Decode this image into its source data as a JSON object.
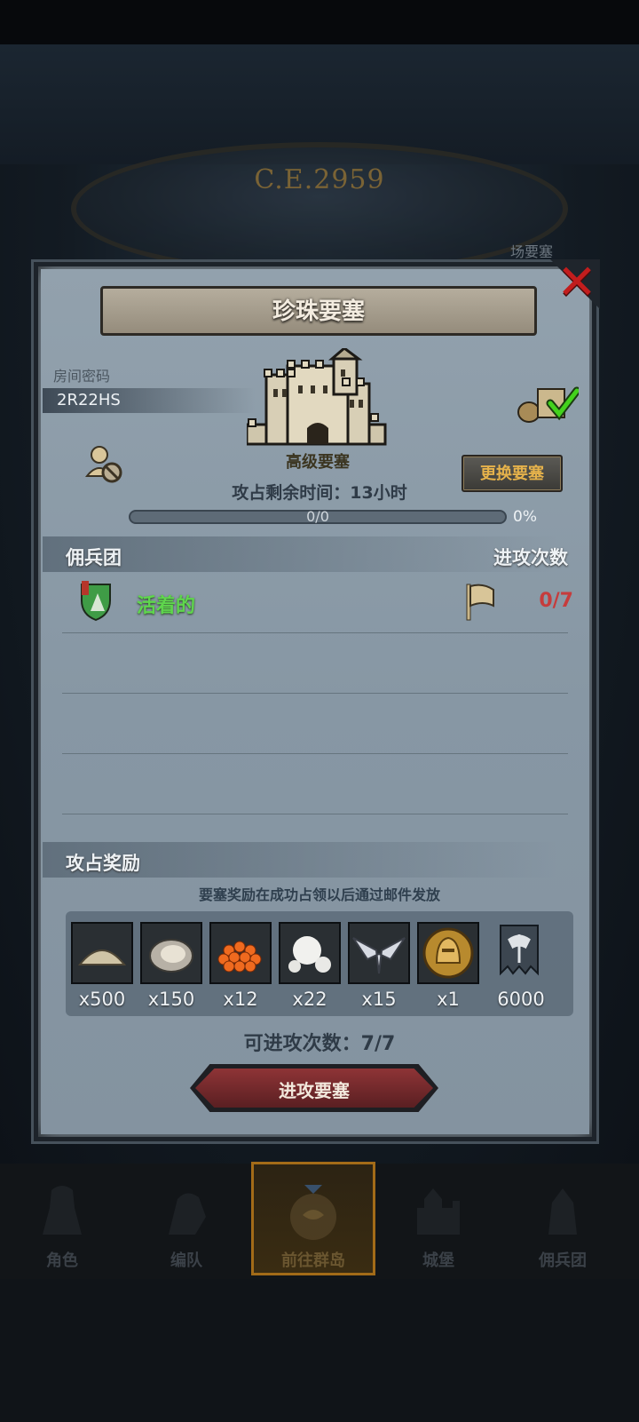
{
  "background": {
    "era": "C.E.2959",
    "fortress_label": "场要塞"
  },
  "dialog": {
    "title": "珍珠要塞",
    "close_icon": "close-icon",
    "room_code_label": "房间密码",
    "room_code": "2R22HS",
    "fortress_level": "高级要塞",
    "change_fortress_button": "更换要塞",
    "remaining_time": "攻占剩余时间：13小时",
    "progress": {
      "text": "0/0",
      "percent_label": "0%",
      "fraction": 0
    },
    "mercenary_header": "佣兵团",
    "attacks_header": "进攻次数",
    "guilds": [
      {
        "name": "活着的",
        "attacks": "0/7",
        "icon": "guild-shield-icon"
      }
    ],
    "rewards_header": "攻占奖励",
    "rewards_note": "要塞奖励在成功占领以后通过邮件发放",
    "rewards": [
      {
        "icon": "sand-icon",
        "qty": "x500"
      },
      {
        "icon": "oyster-icon",
        "qty": "x150"
      },
      {
        "icon": "fish-roe-icon",
        "qty": "x12"
      },
      {
        "icon": "pearl-icon",
        "qty": "x22"
      },
      {
        "icon": "wing-emblem-icon",
        "qty": "x15"
      },
      {
        "icon": "knight-medal-icon",
        "qty": "x1"
      },
      {
        "icon": "guild-banner-icon",
        "qty": "6000"
      }
    ],
    "attackable_count": "可进攻次数：7/7",
    "attack_button": "进攻要塞"
  },
  "nav": [
    {
      "label": "角色",
      "icon": "knight-icon"
    },
    {
      "label": "编队",
      "icon": "formation-icon"
    },
    {
      "label": "前往群岛",
      "icon": "island-icon",
      "active": true
    },
    {
      "label": "城堡",
      "icon": "castle-icon"
    },
    {
      "label": "佣兵团",
      "icon": "mercenary-icon"
    }
  ],
  "colors": {
    "accent_green": "#5fd64d",
    "attack_red": "#c63c3c",
    "gold": "#e6b24b"
  }
}
